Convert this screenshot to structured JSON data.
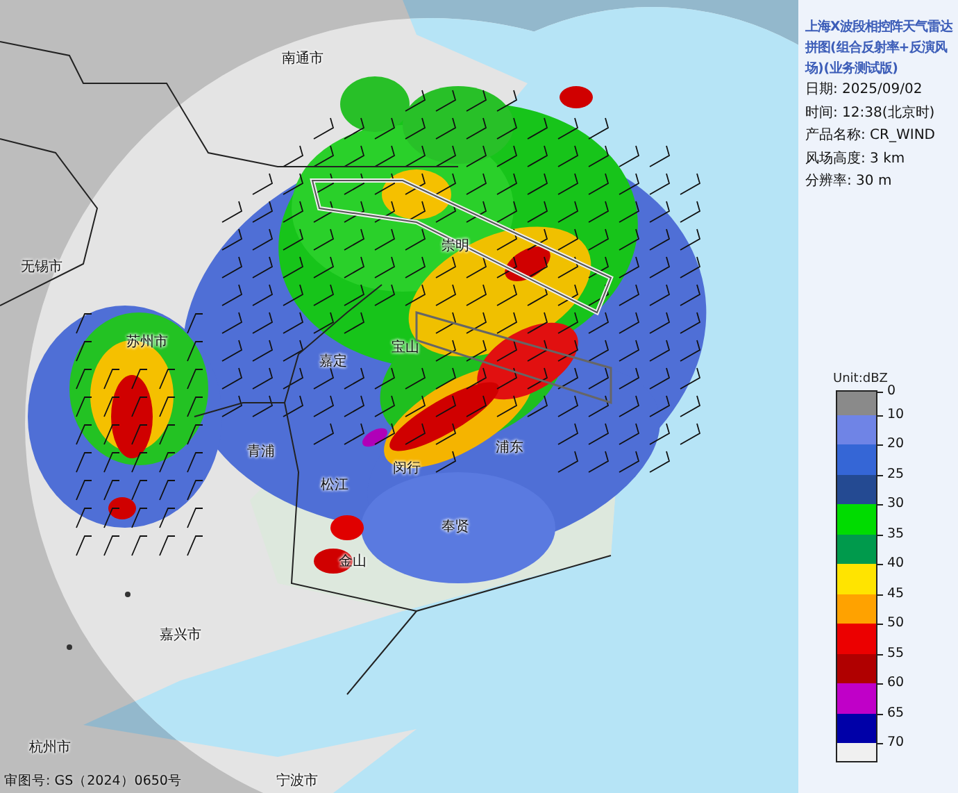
{
  "map": {
    "labels": [
      "南通市",
      "无锡市",
      "苏州市",
      "嘉定",
      "宝山",
      "崇明",
      "青浦",
      "松江",
      "闵行",
      "浦东",
      "奉贤",
      "金山",
      "嘉兴市",
      "杭州市",
      "宁波市"
    ],
    "approval_number": "审图号: GS（2024）0650号"
  },
  "info": {
    "title": "上海X波段相控阵天气雷达拼图(组合反射率+反演风场)(业务测试版)",
    "lines": [
      "日期: 2025/09/02",
      "时间: 12:38(北京时)",
      "产品名称: CR_WIND",
      "风场高度: 3 km",
      "分辨率: 30 m"
    ]
  },
  "legend": {
    "unit": "Unit:dBZ",
    "bands": [
      {
        "tick": "0",
        "color": "#8a8a8a"
      },
      {
        "tick": "10",
        "color": "#6f84e6"
      },
      {
        "tick": "20",
        "color": "#3566d6"
      },
      {
        "tick": "25",
        "color": "#244a92"
      },
      {
        "tick": "30",
        "color": "#00dc00"
      },
      {
        "tick": "35",
        "color": "#009a4c"
      },
      {
        "tick": "40",
        "color": "#ffe400"
      },
      {
        "tick": "45",
        "color": "#ffa200"
      },
      {
        "tick": "50",
        "color": "#ec0000"
      },
      {
        "tick": "55",
        "color": "#b00000"
      },
      {
        "tick": "60",
        "color": "#c000c8"
      },
      {
        "tick": "65",
        "color": "#0000a8"
      },
      {
        "tick": "70",
        "color": "#f0f0f0"
      }
    ]
  }
}
